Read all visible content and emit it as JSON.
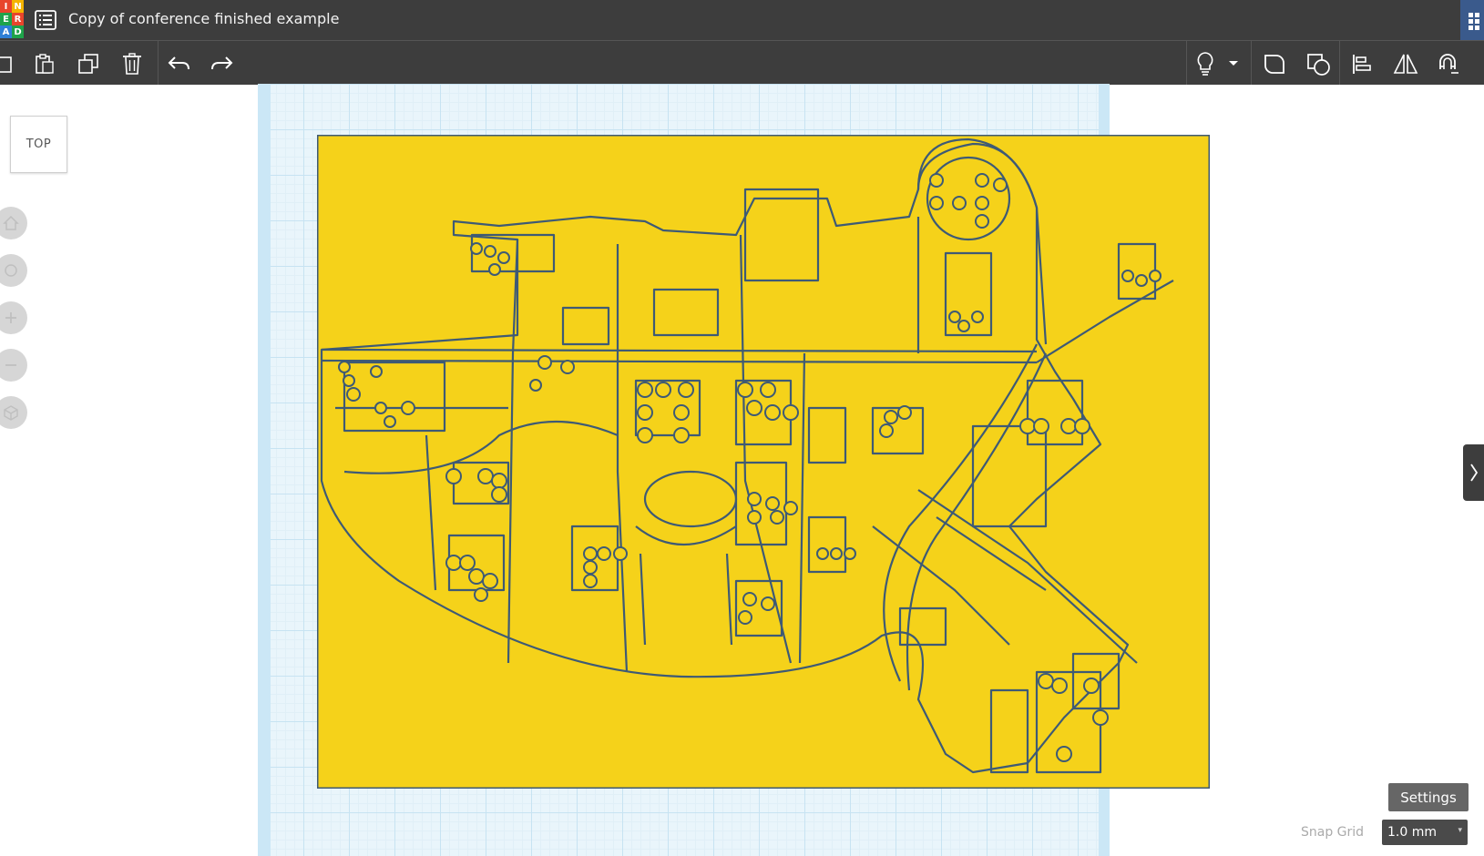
{
  "app": {
    "logo_letters": [
      "I",
      "N",
      "E",
      "R",
      "A",
      "D"
    ],
    "logo_colors": [
      "#e8452c",
      "#f4b400",
      "#1fa34a",
      "#e8452c",
      "#2f7fd6",
      "#1fa34a"
    ],
    "document_title": "Copy of conference finished example"
  },
  "toolbar": {
    "left_icons": [
      "copy-icon",
      "paste-icon",
      "duplicate-icon",
      "delete-icon",
      "undo-icon",
      "redo-icon"
    ],
    "right_icons": [
      "light-bulb-icon",
      "dropdown-arrow-icon",
      "group-icon",
      "ungroup-icon",
      "align-icon",
      "mirror-icon",
      "magnet-icon"
    ]
  },
  "viewcube": {
    "label": "TOP"
  },
  "nav": {
    "icons": [
      "home-icon",
      "orbit-icon",
      "zoom-in-icon",
      "zoom-out-icon",
      "perspective-icon"
    ]
  },
  "colors": {
    "chrome": "#3d3d3d",
    "map_fill": "#f5d21a",
    "map_stroke": "#3e5a75",
    "workplane": "#e9f5fb"
  },
  "bottom": {
    "settings_label": "Settings",
    "snap_label": "Snap Grid",
    "snap_value": "1.0 mm"
  }
}
